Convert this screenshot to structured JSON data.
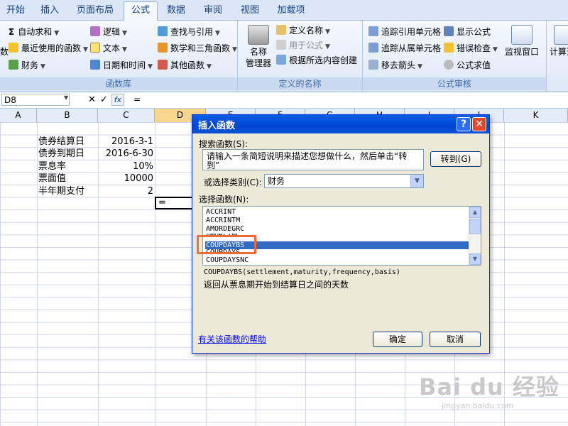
{
  "tabs": [
    "开始",
    "插入",
    "页面布局",
    "公式",
    "数据",
    "审阅",
    "视图",
    "加载项"
  ],
  "active_tab": "公式",
  "ribbon": {
    "function_library": {
      "label": "函数库",
      "autosum": "自动求和",
      "recent": "最近使用的函数",
      "finance": "财务",
      "logic": "逻辑",
      "text": "文本",
      "datetime": "日期和时间",
      "lookup": "查找与引用",
      "math": "数学和三角函数",
      "other": "其他函数",
      "insert_cut": "数"
    },
    "defined_names": {
      "label": "定义的名称",
      "manager": "名称\n管理器",
      "define": "定义名称",
      "use": "用于公式",
      "create": "根据所选内容创建"
    },
    "audit": {
      "label": "公式审核",
      "trace_precedents": "追踪引用单元格",
      "trace_dependents": "追踪从属单元格",
      "remove_arrows": "移去箭头",
      "show_formulas": "显示公式",
      "error_check": "错误检查",
      "evaluate": "公式求值",
      "watch": "监视窗口"
    },
    "calc": {
      "label": "计算选"
    }
  },
  "formula_bar": {
    "name_box": "D8",
    "cancel": "✕",
    "enter": "✓",
    "fx": "fx",
    "value": "="
  },
  "columns": [
    "A",
    "B",
    "C",
    "D",
    "E",
    "F",
    "G",
    "H",
    "I",
    "J",
    "K"
  ],
  "cells": [
    {
      "label": "债券结算日",
      "value": "2016-3-1"
    },
    {
      "label": "债券到期日",
      "value": "2016-6-30"
    },
    {
      "label": "票息率",
      "value": "10%"
    },
    {
      "label": "票面值",
      "value": "10000"
    },
    {
      "label": "半年期支付",
      "value": "2"
    }
  ],
  "active_cell_value": "=",
  "dialog": {
    "title": "插入函数",
    "search_label": "搜索函数(S):",
    "search_text": "请输入一条简短说明来描述您想做什么，然后单击“转到”",
    "go_button": "转到(G)",
    "category_label": "或选择类别(C):",
    "category_value": "财务",
    "select_label": "选择函数(N):",
    "functions": [
      "ACCRINT",
      "ACCRINTM",
      "AMORDEGRC",
      "AMORLINC",
      "COUPDAYBS",
      "COUPDAYS",
      "COUPDAYSNC"
    ],
    "selected_function": "COUPDAYBS",
    "signature": "COUPDAYBS(settlement,maturity,frequency,basis)",
    "description": "返回从票息期开始到结算日之间的天数",
    "help_link": "有关该函数的帮助",
    "ok": "确定",
    "cancel": "取消",
    "help_btn": "?",
    "close_btn": "✕"
  },
  "watermark": "Bai du 经验",
  "watermark_url": "jingyan.baidu.com",
  "colors": {
    "tab_text": "#15428b",
    "selection": "#316ac5",
    "title_bar": "#0046d5",
    "highlight_box": "#f06a3a"
  }
}
